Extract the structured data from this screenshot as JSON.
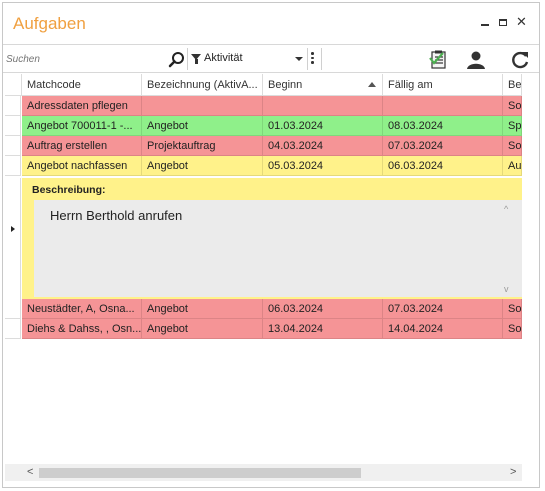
{
  "window": {
    "title": "Aufgaben",
    "controls": {
      "minimize": "minimize-icon",
      "maximize": "maximize-icon",
      "close": "✕"
    }
  },
  "toolbar": {
    "search_placeholder": "Suchen",
    "filter_label": "Aktivität",
    "icons": [
      "search-icon",
      "filter-icon",
      "checklist-icon",
      "user-icon",
      "refresh-icon"
    ]
  },
  "columns": [
    "Matchcode",
    "Bezeichnung (AktivA...",
    "Beginn",
    "Fällig am",
    "Be"
  ],
  "sort": {
    "column": "Beginn",
    "direction": "ascending"
  },
  "colors": {
    "red": "#f59496",
    "green": "#8ff08a",
    "yellow": "#fff28a",
    "title": "#f0a040"
  },
  "rows": [
    {
      "matchcode": "Adressdaten pflegen",
      "bezeichnung": "",
      "beginn": "",
      "faellig": "",
      "be": "Sof",
      "color": "#f59496"
    },
    {
      "matchcode": "Angebot 700011-1 -...",
      "bezeichnung": "Angebot",
      "beginn": "01.03.2024",
      "faellig": "08.03.2024",
      "be": "Spä",
      "color": "#8ff08a"
    },
    {
      "matchcode": "Auftrag erstellen",
      "bezeichnung": "Projektauftrag",
      "beginn": "04.03.2024",
      "faellig": "07.03.2024",
      "be": "Sof",
      "color": "#f59496"
    },
    {
      "matchcode": "Angebot nachfassen",
      "bezeichnung": "Angebot",
      "beginn": "05.03.2024",
      "faellig": "06.03.2024",
      "be": "Auf",
      "color": "#fff28a"
    },
    {
      "matchcode": "Neustädter, A, Osna...",
      "bezeichnung": "Angebot",
      "beginn": "06.03.2024",
      "faellig": "07.03.2024",
      "be": "Sof",
      "color": "#f59496"
    },
    {
      "matchcode": "Diehs & Dahss, , Osn...",
      "bezeichnung": "Angebot",
      "beginn": "13.04.2024",
      "faellig": "14.04.2024",
      "be": "Sof",
      "color": "#f59496"
    }
  ],
  "detail": {
    "label": "Beschreibung:",
    "text": "Herrn Berthold anrufen"
  },
  "scrollbar": {
    "left": "<",
    "right": ">",
    "up": "^",
    "down": "v"
  }
}
